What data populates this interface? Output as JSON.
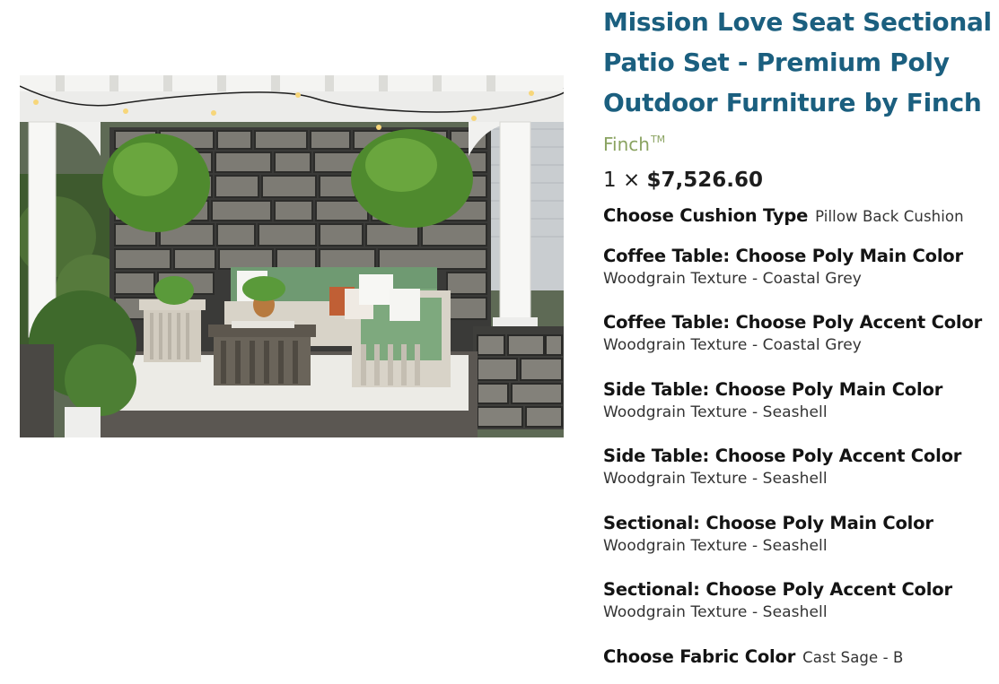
{
  "product": {
    "title": "Mission Love Seat Sectional Patio Set - Premium Poly Outdoor Furniture by Finch",
    "brand": "Finch",
    "brand_mark": "TM",
    "quantity_prefix": "1 ×",
    "price": "$7,526.60"
  },
  "options": [
    {
      "label": "Choose Cushion Type",
      "value": "Pillow Back Cushion"
    },
    {
      "label": "Coffee Table: Choose Poly Main Color",
      "value": "Woodgrain Texture - Coastal Grey"
    },
    {
      "label": "Coffee Table: Choose Poly Accent Color",
      "value": "Woodgrain Texture - Coastal Grey"
    },
    {
      "label": "Side Table: Choose Poly Main Color",
      "value": "Woodgrain Texture - Seashell"
    },
    {
      "label": "Side Table: Choose Poly Accent Color",
      "value": "Woodgrain Texture - Seashell"
    },
    {
      "label": "Sectional: Choose Poly Main Color",
      "value": "Woodgrain Texture - Seashell"
    },
    {
      "label": "Sectional: Choose Poly Accent Color",
      "value": "Woodgrain Texture - Seashell"
    },
    {
      "label": "Choose Fabric Color",
      "value": "Cast Sage - B"
    }
  ],
  "colors": {
    "title": "#1b5f7f",
    "brand": "#8aa361"
  }
}
